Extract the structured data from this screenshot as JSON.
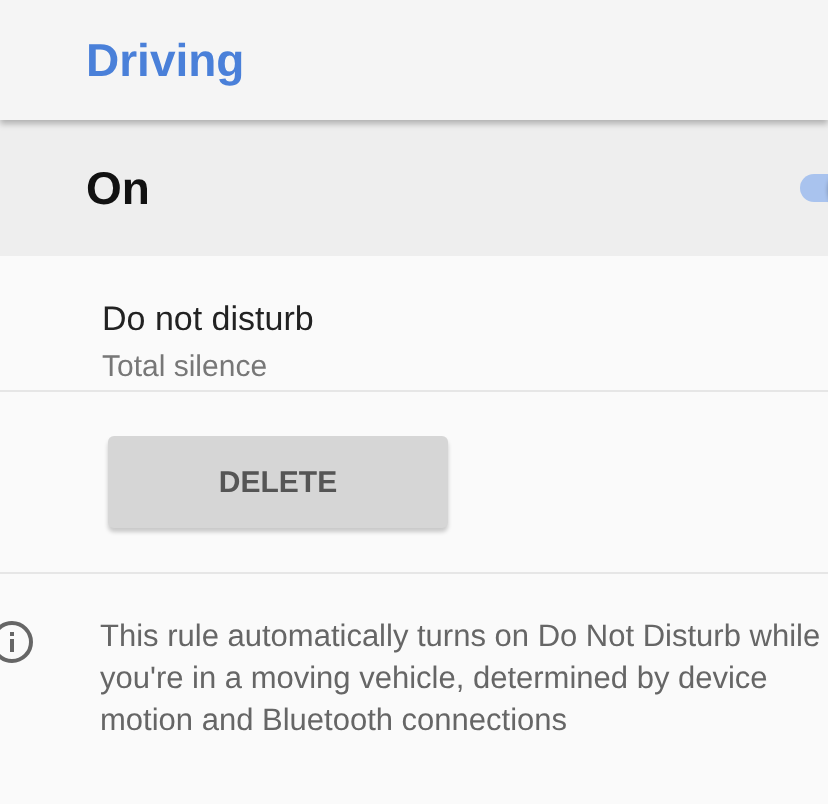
{
  "title": "Driving",
  "master": {
    "label": "On",
    "on": true
  },
  "rule": {
    "title": "Do not disturb",
    "subtitle": "Total silence"
  },
  "delete_button": "DELETE",
  "info": "This rule automatically turns on Do Not Disturb while you're in a moving vehicle, determined by device motion and Bluetooth connections"
}
